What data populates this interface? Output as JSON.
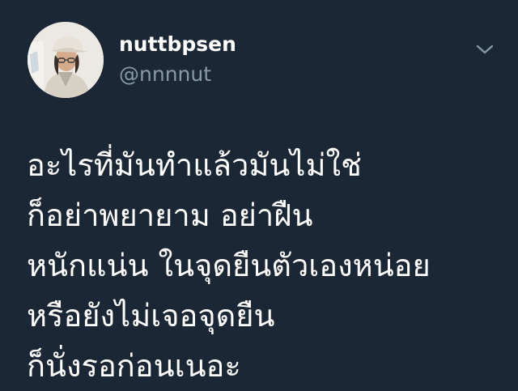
{
  "tweet": {
    "author": {
      "display_name": "nuttbpsen",
      "handle": "@nnnnut",
      "avatar_icon": "profile-photo"
    },
    "menu_icon": "chevron-down-icon",
    "body_lines": [
      "อะไรที่มันทำแล้วมันไม่ใช่",
      "ก็อย่าพยายาม อย่าฝืน",
      "หนักแน่น ในจุดยืนตัวเองหน่อย",
      "หรือยังไม่เจอจุดยืน",
      "ก็นั่งรอก่อนเนอะ"
    ]
  },
  "colors": {
    "background": "#1b2734",
    "text": "#ffffff",
    "secondary_text": "#8899a6"
  }
}
